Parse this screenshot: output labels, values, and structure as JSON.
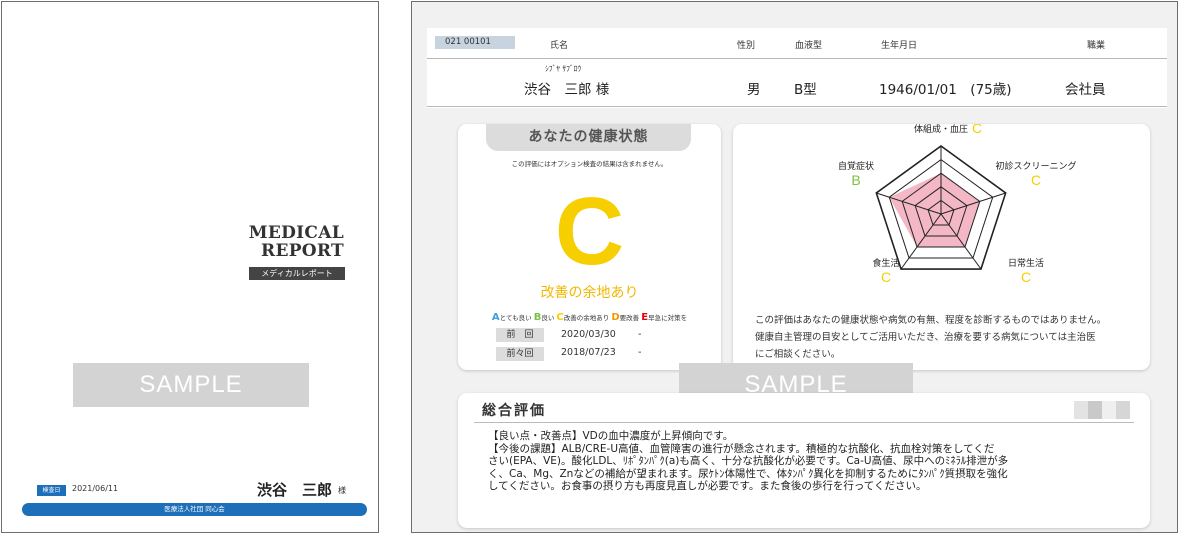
{
  "cover": {
    "title_line1": "MEDICAL",
    "title_line2": "REPORT",
    "subtitle": "メディカルレポート",
    "watermark": "SAMPLE",
    "date_tag": "検査日",
    "date": "2021/06/11",
    "patient_name": "渋谷　三郎",
    "name_suffix": "様",
    "organization": "医療法人社団 同心会",
    "colors": {
      "accent": "#1c6fb8"
    }
  },
  "report": {
    "header": {
      "id": "021 00101",
      "labels": {
        "name": "氏名",
        "sex": "性別",
        "blood_type": "血液型",
        "dob": "生年月日",
        "occupation": "職業"
      },
      "kana": "ｼﾌﾞﾔ ｻﾌﾞﾛｳ",
      "name": "渋谷　三郎 様",
      "sex": "男",
      "blood_type": "B型",
      "dob": "1946/01/01　(75歳)",
      "occupation": "会社員"
    },
    "health_state": {
      "title": "あなたの健康状態",
      "note": "この評価にはオプション検査の結果は含まれません。",
      "grade": "C",
      "grade_text": "改善の余地あり",
      "legend": [
        {
          "letter": "A",
          "text": "とても良い",
          "color": "#3aa0e0"
        },
        {
          "letter": "B",
          "text": "良い",
          "color": "#7ac143"
        },
        {
          "letter": "C",
          "text": "改善の余地あり",
          "color": "#f7cf00"
        },
        {
          "letter": "D",
          "text": "要改善",
          "color": "#f39800"
        },
        {
          "letter": "E",
          "text": "早急に対策を",
          "color": "#e60012"
        }
      ],
      "history": [
        {
          "label": "前　回",
          "date": "2020/03/30",
          "result": "-"
        },
        {
          "label": "前々回",
          "date": "2018/07/23",
          "result": "-"
        }
      ]
    },
    "radar": {
      "axes": [
        {
          "label": "体組成・血圧",
          "grade": "C",
          "color": "#f7cf00",
          "level": 3
        },
        {
          "label": "初診スクリーニング",
          "grade": "C",
          "color": "#f7cf00",
          "level": 3
        },
        {
          "label": "日常生活",
          "grade": "C",
          "color": "#f7cf00",
          "level": 3
        },
        {
          "label": "食生活",
          "grade": "C",
          "color": "#f7cf00",
          "level": 3
        },
        {
          "label": "自覚症状",
          "grade": "B",
          "color": "#7ac143",
          "level": 4
        }
      ],
      "max_level": 5,
      "fill_color": "#f3b7c6",
      "note_lines": [
        "この評価はあなたの健康状態や病気の有無、程度を診断するものではありません。",
        "健康自主管理の目安としてご活用いただき、治療を要する病気については主治医",
        "にご相談ください。"
      ]
    },
    "watermark": "SAMPLE",
    "summary": {
      "title": "総合評価",
      "lines": [
        "【良い点・改善点】VDの血中濃度が上昇傾向です。",
        "【今後の課題】ALB/CRE-U高値、血管障害の進行が懸念されます。積極的な抗酸化、抗血栓対策をしてくだ",
        "さい(EPA、VE)。酸化LDL、ﾘﾎﾟﾀﾝﾊﾟｸ(a)も高く、十分な抗酸化が必要です。Ca-U高値、尿中へのﾐﾈﾗﾙ排泄が多",
        "く、Ca、Mg、Znなどの補給が望まれます。尿ｹﾄﾝ体陽性で、体ﾀﾝﾊﾟｸ異化を抑制するためにﾀﾝﾊﾟｸ質摂取を強化",
        "してください。お食事の摂り方も再度見直しが必要です。また食後の歩行を行ってください。"
      ]
    }
  }
}
